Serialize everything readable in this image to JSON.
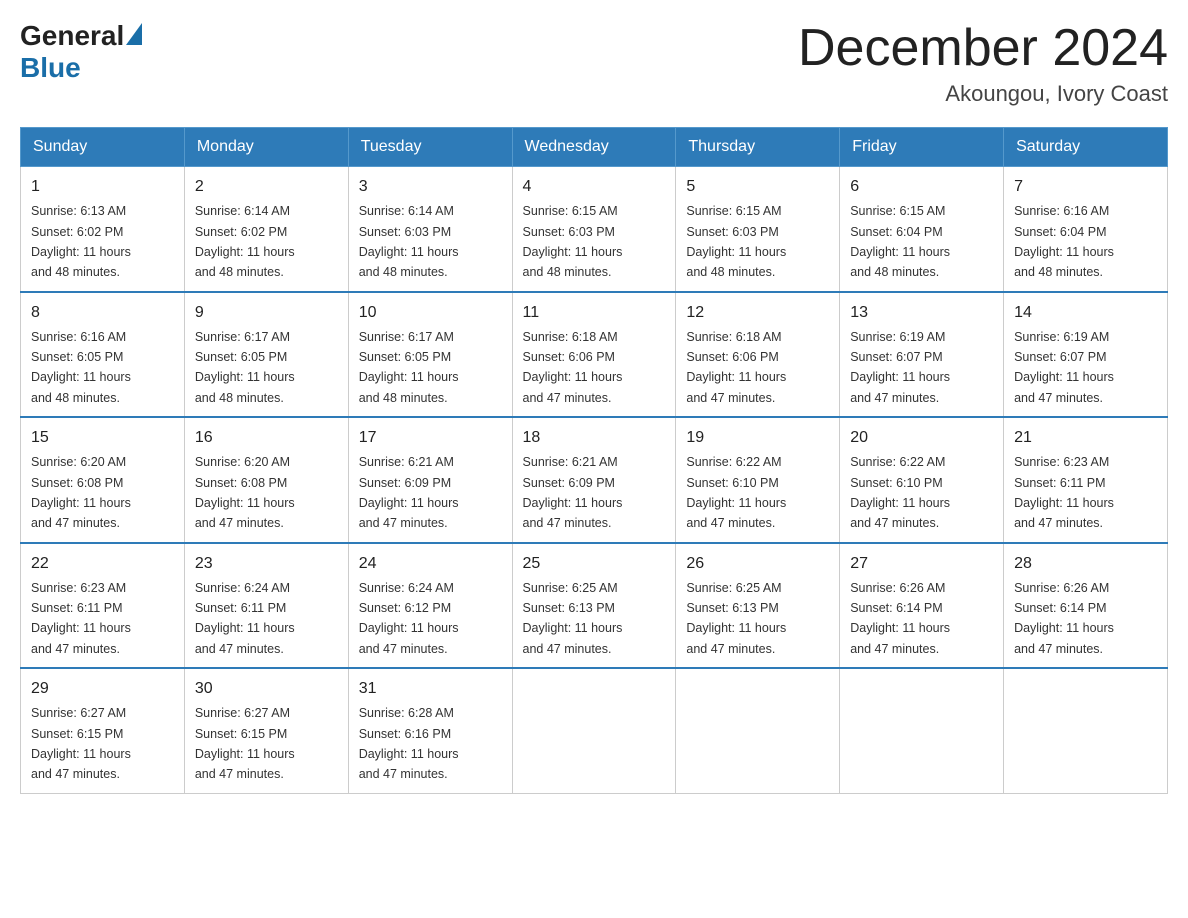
{
  "logo": {
    "general": "General",
    "blue": "Blue"
  },
  "header": {
    "month": "December 2024",
    "location": "Akoungou, Ivory Coast"
  },
  "weekdays": [
    "Sunday",
    "Monday",
    "Tuesday",
    "Wednesday",
    "Thursday",
    "Friday",
    "Saturday"
  ],
  "weeks": [
    [
      {
        "day": "1",
        "sunrise": "6:13 AM",
        "sunset": "6:02 PM",
        "daylight": "11 hours and 48 minutes."
      },
      {
        "day": "2",
        "sunrise": "6:14 AM",
        "sunset": "6:02 PM",
        "daylight": "11 hours and 48 minutes."
      },
      {
        "day": "3",
        "sunrise": "6:14 AM",
        "sunset": "6:03 PM",
        "daylight": "11 hours and 48 minutes."
      },
      {
        "day": "4",
        "sunrise": "6:15 AM",
        "sunset": "6:03 PM",
        "daylight": "11 hours and 48 minutes."
      },
      {
        "day": "5",
        "sunrise": "6:15 AM",
        "sunset": "6:03 PM",
        "daylight": "11 hours and 48 minutes."
      },
      {
        "day": "6",
        "sunrise": "6:15 AM",
        "sunset": "6:04 PM",
        "daylight": "11 hours and 48 minutes."
      },
      {
        "day": "7",
        "sunrise": "6:16 AM",
        "sunset": "6:04 PM",
        "daylight": "11 hours and 48 minutes."
      }
    ],
    [
      {
        "day": "8",
        "sunrise": "6:16 AM",
        "sunset": "6:05 PM",
        "daylight": "11 hours and 48 minutes."
      },
      {
        "day": "9",
        "sunrise": "6:17 AM",
        "sunset": "6:05 PM",
        "daylight": "11 hours and 48 minutes."
      },
      {
        "day": "10",
        "sunrise": "6:17 AM",
        "sunset": "6:05 PM",
        "daylight": "11 hours and 48 minutes."
      },
      {
        "day": "11",
        "sunrise": "6:18 AM",
        "sunset": "6:06 PM",
        "daylight": "11 hours and 47 minutes."
      },
      {
        "day": "12",
        "sunrise": "6:18 AM",
        "sunset": "6:06 PM",
        "daylight": "11 hours and 47 minutes."
      },
      {
        "day": "13",
        "sunrise": "6:19 AM",
        "sunset": "6:07 PM",
        "daylight": "11 hours and 47 minutes."
      },
      {
        "day": "14",
        "sunrise": "6:19 AM",
        "sunset": "6:07 PM",
        "daylight": "11 hours and 47 minutes."
      }
    ],
    [
      {
        "day": "15",
        "sunrise": "6:20 AM",
        "sunset": "6:08 PM",
        "daylight": "11 hours and 47 minutes."
      },
      {
        "day": "16",
        "sunrise": "6:20 AM",
        "sunset": "6:08 PM",
        "daylight": "11 hours and 47 minutes."
      },
      {
        "day": "17",
        "sunrise": "6:21 AM",
        "sunset": "6:09 PM",
        "daylight": "11 hours and 47 minutes."
      },
      {
        "day": "18",
        "sunrise": "6:21 AM",
        "sunset": "6:09 PM",
        "daylight": "11 hours and 47 minutes."
      },
      {
        "day": "19",
        "sunrise": "6:22 AM",
        "sunset": "6:10 PM",
        "daylight": "11 hours and 47 minutes."
      },
      {
        "day": "20",
        "sunrise": "6:22 AM",
        "sunset": "6:10 PM",
        "daylight": "11 hours and 47 minutes."
      },
      {
        "day": "21",
        "sunrise": "6:23 AM",
        "sunset": "6:11 PM",
        "daylight": "11 hours and 47 minutes."
      }
    ],
    [
      {
        "day": "22",
        "sunrise": "6:23 AM",
        "sunset": "6:11 PM",
        "daylight": "11 hours and 47 minutes."
      },
      {
        "day": "23",
        "sunrise": "6:24 AM",
        "sunset": "6:11 PM",
        "daylight": "11 hours and 47 minutes."
      },
      {
        "day": "24",
        "sunrise": "6:24 AM",
        "sunset": "6:12 PM",
        "daylight": "11 hours and 47 minutes."
      },
      {
        "day": "25",
        "sunrise": "6:25 AM",
        "sunset": "6:13 PM",
        "daylight": "11 hours and 47 minutes."
      },
      {
        "day": "26",
        "sunrise": "6:25 AM",
        "sunset": "6:13 PM",
        "daylight": "11 hours and 47 minutes."
      },
      {
        "day": "27",
        "sunrise": "6:26 AM",
        "sunset": "6:14 PM",
        "daylight": "11 hours and 47 minutes."
      },
      {
        "day": "28",
        "sunrise": "6:26 AM",
        "sunset": "6:14 PM",
        "daylight": "11 hours and 47 minutes."
      }
    ],
    [
      {
        "day": "29",
        "sunrise": "6:27 AM",
        "sunset": "6:15 PM",
        "daylight": "11 hours and 47 minutes."
      },
      {
        "day": "30",
        "sunrise": "6:27 AM",
        "sunset": "6:15 PM",
        "daylight": "11 hours and 47 minutes."
      },
      {
        "day": "31",
        "sunrise": "6:28 AM",
        "sunset": "6:16 PM",
        "daylight": "11 hours and 47 minutes."
      },
      null,
      null,
      null,
      null
    ]
  ],
  "labels": {
    "sunrise": "Sunrise:",
    "sunset": "Sunset:",
    "daylight": "Daylight:"
  }
}
